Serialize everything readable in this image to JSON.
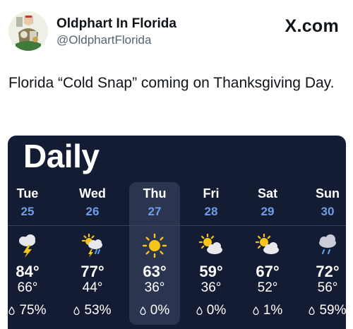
{
  "header": {
    "display_name": "Oldphart In Florida",
    "handle": "@OldphartFlorida",
    "brand": "X.com"
  },
  "tweet": {
    "text": "Florida “Cold Snap” coming on Thanksgiving Day."
  },
  "forecast": {
    "title": "Daily",
    "days": [
      {
        "day": "Tue",
        "date": "25",
        "icon": "thunderstorm-icon",
        "high": "84°",
        "low": "66°",
        "precip": "75%"
      },
      {
        "day": "Wed",
        "date": "26",
        "icon": "partly-sunny-thunderstorm-icon",
        "high": "77°",
        "low": "44°",
        "precip": "53%"
      },
      {
        "day": "Thu",
        "date": "27",
        "icon": "sunny-icon",
        "high": "63°",
        "low": "36°",
        "precip": "0%"
      },
      {
        "day": "Fri",
        "date": "28",
        "icon": "partly-cloudy-icon",
        "high": "59°",
        "low": "36°",
        "precip": "0%"
      },
      {
        "day": "Sat",
        "date": "29",
        "icon": "partly-cloudy-icon",
        "high": "67°",
        "low": "52°",
        "precip": "1%"
      },
      {
        "day": "Sun",
        "date": "30",
        "icon": "rain-icon",
        "high": "72°",
        "low": "56°",
        "precip": "59%"
      }
    ],
    "highlighted_day": "Thu",
    "colors": {
      "background": "#141c33",
      "highlight": "#2c3550",
      "date": "#6f9ee8",
      "sun": "#f5c518"
    }
  }
}
